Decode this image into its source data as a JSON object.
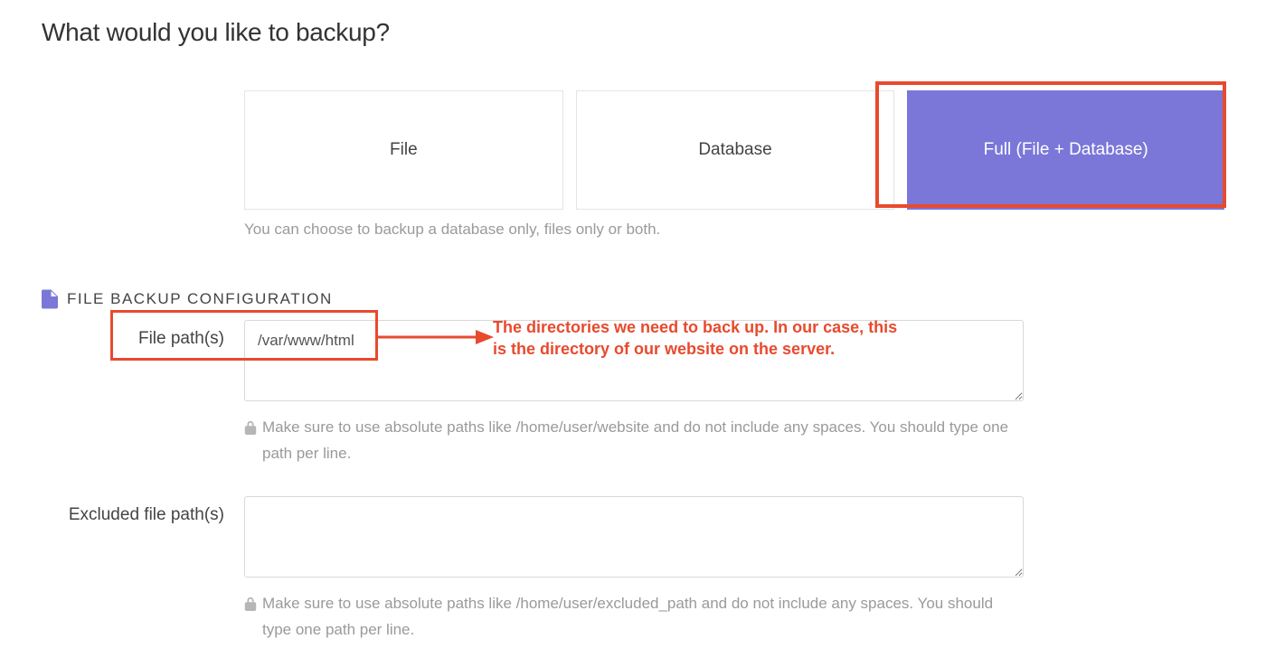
{
  "page_title": "What would you like to backup?",
  "options": {
    "file": "File",
    "database": "Database",
    "full": "Full (File + Database)",
    "helper": "You can choose to backup a database only, files only or both."
  },
  "section": {
    "title": "FILE BACKUP CONFIGURATION"
  },
  "file_paths": {
    "label": "File path(s)",
    "value": "/var/www/html",
    "help": "Make sure to use absolute paths like /home/user/website and do not include any spaces. You should type one path per line."
  },
  "excluded_paths": {
    "label": "Excluded file path(s)",
    "value": "",
    "help": "Make sure to use absolute paths like /home/user/excluded_path and do not include any spaces. You should type one path per line."
  },
  "annotation": {
    "text": "The directories we need to back up. In our case, this is the directory of our website on the server."
  }
}
